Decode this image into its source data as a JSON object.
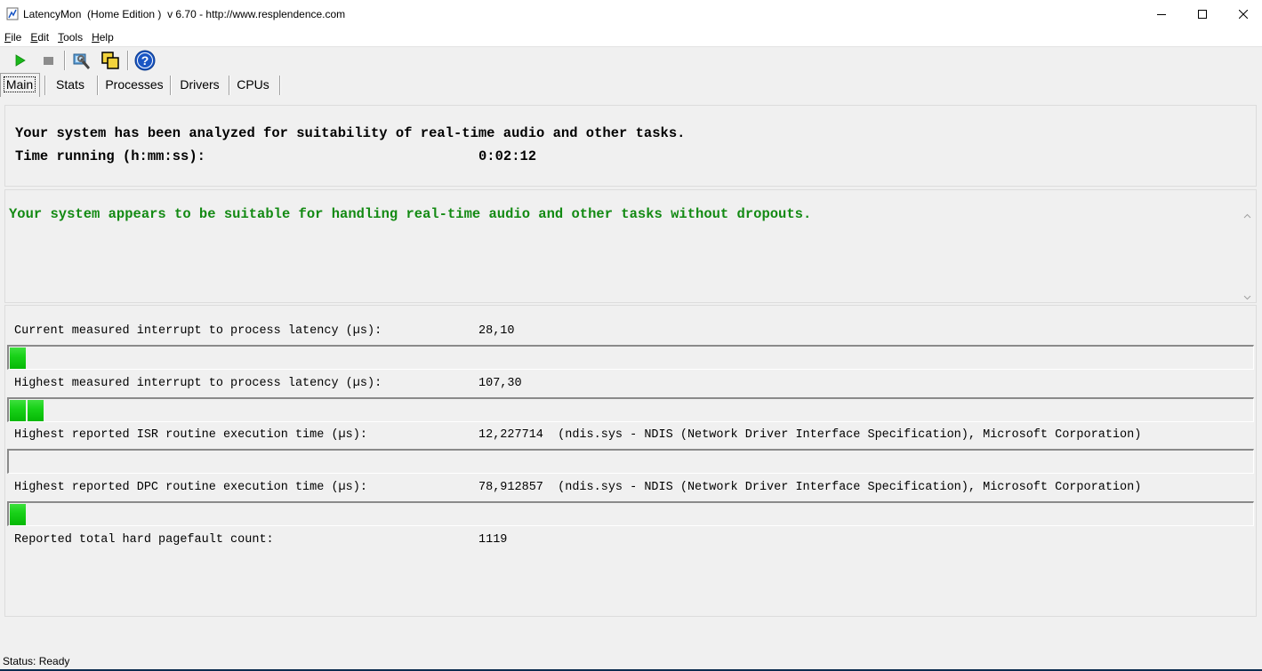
{
  "window": {
    "title": "LatencyMon  (Home Edition )  v 6.70 - http://www.resplendence.com"
  },
  "menu": {
    "items": [
      {
        "mnemonic": "F",
        "rest": "ile"
      },
      {
        "mnemonic": "E",
        "rest": "dit"
      },
      {
        "mnemonic": "T",
        "rest": "ools"
      },
      {
        "mnemonic": "H",
        "rest": "elp"
      }
    ]
  },
  "toolbar": {
    "icons": [
      "play-icon",
      "stop-icon",
      "driver-tool-icon",
      "windows-icon",
      "help-icon"
    ],
    "colors": {
      "play": "#1ab81a",
      "stop": "#8c8c8c",
      "help": "#1a56c4"
    }
  },
  "tabs": {
    "items": [
      "Main",
      "Stats",
      "Processes",
      "Drivers",
      "CPUs"
    ],
    "active": "Main"
  },
  "summary": {
    "headline": "Your system has been analyzed for suitability of real-time audio and other tasks.",
    "time_label": "Time running (h:mm:ss):",
    "time_value": "0:02:12"
  },
  "verdict": {
    "text": "Your system appears to be suitable for handling real-time audio and other tasks without dropouts.",
    "color": "#138a13"
  },
  "metrics": [
    {
      "label": "Current measured interrupt to process latency (µs):",
      "value": "28,10",
      "bar_segments": 1
    },
    {
      "label": "Highest measured interrupt to process latency (µs):",
      "value": "107,30",
      "bar_segments": 2
    },
    {
      "label": "Highest reported ISR routine execution time (µs):",
      "value": "12,227714  (ndis.sys - NDIS (Network Driver Interface Specification), Microsoft Corporation)",
      "bar_segments": 0
    },
    {
      "label": "Highest reported DPC routine execution time (µs):",
      "value": "78,912857  (ndis.sys - NDIS (Network Driver Interface Specification), Microsoft Corporation)",
      "bar_segments": 1
    }
  ],
  "pagefault": {
    "label": "Reported total hard pagefault count:",
    "value": "1119"
  },
  "status": {
    "text": "Status: Ready"
  }
}
